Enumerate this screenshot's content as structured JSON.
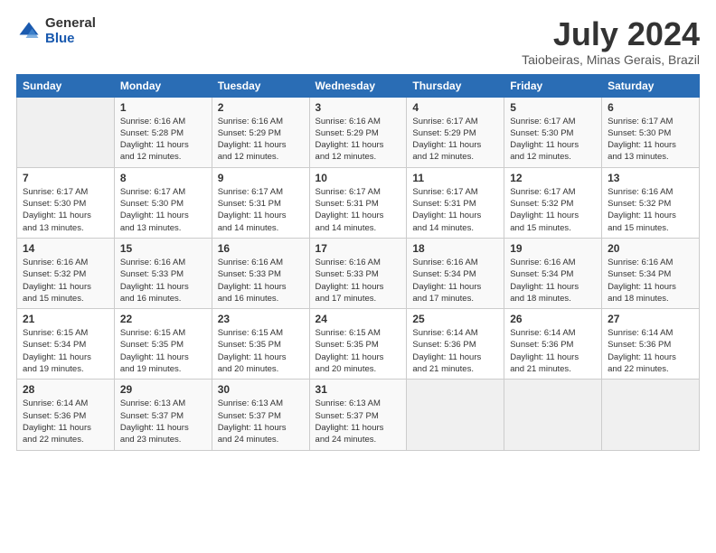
{
  "header": {
    "logo_general": "General",
    "logo_blue": "Blue",
    "main_title": "July 2024",
    "subtitle": "Taiobeiras, Minas Gerais, Brazil"
  },
  "days_of_week": [
    "Sunday",
    "Monday",
    "Tuesday",
    "Wednesday",
    "Thursday",
    "Friday",
    "Saturday"
  ],
  "weeks": [
    [
      {
        "day": "",
        "info": ""
      },
      {
        "day": "1",
        "info": "Sunrise: 6:16 AM\nSunset: 5:28 PM\nDaylight: 11 hours\nand 12 minutes."
      },
      {
        "day": "2",
        "info": "Sunrise: 6:16 AM\nSunset: 5:29 PM\nDaylight: 11 hours\nand 12 minutes."
      },
      {
        "day": "3",
        "info": "Sunrise: 6:16 AM\nSunset: 5:29 PM\nDaylight: 11 hours\nand 12 minutes."
      },
      {
        "day": "4",
        "info": "Sunrise: 6:17 AM\nSunset: 5:29 PM\nDaylight: 11 hours\nand 12 minutes."
      },
      {
        "day": "5",
        "info": "Sunrise: 6:17 AM\nSunset: 5:30 PM\nDaylight: 11 hours\nand 12 minutes."
      },
      {
        "day": "6",
        "info": "Sunrise: 6:17 AM\nSunset: 5:30 PM\nDaylight: 11 hours\nand 13 minutes."
      }
    ],
    [
      {
        "day": "7",
        "info": "Sunrise: 6:17 AM\nSunset: 5:30 PM\nDaylight: 11 hours\nand 13 minutes."
      },
      {
        "day": "8",
        "info": "Sunrise: 6:17 AM\nSunset: 5:30 PM\nDaylight: 11 hours\nand 13 minutes."
      },
      {
        "day": "9",
        "info": "Sunrise: 6:17 AM\nSunset: 5:31 PM\nDaylight: 11 hours\nand 14 minutes."
      },
      {
        "day": "10",
        "info": "Sunrise: 6:17 AM\nSunset: 5:31 PM\nDaylight: 11 hours\nand 14 minutes."
      },
      {
        "day": "11",
        "info": "Sunrise: 6:17 AM\nSunset: 5:31 PM\nDaylight: 11 hours\nand 14 minutes."
      },
      {
        "day": "12",
        "info": "Sunrise: 6:17 AM\nSunset: 5:32 PM\nDaylight: 11 hours\nand 15 minutes."
      },
      {
        "day": "13",
        "info": "Sunrise: 6:16 AM\nSunset: 5:32 PM\nDaylight: 11 hours\nand 15 minutes."
      }
    ],
    [
      {
        "day": "14",
        "info": "Sunrise: 6:16 AM\nSunset: 5:32 PM\nDaylight: 11 hours\nand 15 minutes."
      },
      {
        "day": "15",
        "info": "Sunrise: 6:16 AM\nSunset: 5:33 PM\nDaylight: 11 hours\nand 16 minutes."
      },
      {
        "day": "16",
        "info": "Sunrise: 6:16 AM\nSunset: 5:33 PM\nDaylight: 11 hours\nand 16 minutes."
      },
      {
        "day": "17",
        "info": "Sunrise: 6:16 AM\nSunset: 5:33 PM\nDaylight: 11 hours\nand 17 minutes."
      },
      {
        "day": "18",
        "info": "Sunrise: 6:16 AM\nSunset: 5:34 PM\nDaylight: 11 hours\nand 17 minutes."
      },
      {
        "day": "19",
        "info": "Sunrise: 6:16 AM\nSunset: 5:34 PM\nDaylight: 11 hours\nand 18 minutes."
      },
      {
        "day": "20",
        "info": "Sunrise: 6:16 AM\nSunset: 5:34 PM\nDaylight: 11 hours\nand 18 minutes."
      }
    ],
    [
      {
        "day": "21",
        "info": "Sunrise: 6:15 AM\nSunset: 5:34 PM\nDaylight: 11 hours\nand 19 minutes."
      },
      {
        "day": "22",
        "info": "Sunrise: 6:15 AM\nSunset: 5:35 PM\nDaylight: 11 hours\nand 19 minutes."
      },
      {
        "day": "23",
        "info": "Sunrise: 6:15 AM\nSunset: 5:35 PM\nDaylight: 11 hours\nand 20 minutes."
      },
      {
        "day": "24",
        "info": "Sunrise: 6:15 AM\nSunset: 5:35 PM\nDaylight: 11 hours\nand 20 minutes."
      },
      {
        "day": "25",
        "info": "Sunrise: 6:14 AM\nSunset: 5:36 PM\nDaylight: 11 hours\nand 21 minutes."
      },
      {
        "day": "26",
        "info": "Sunrise: 6:14 AM\nSunset: 5:36 PM\nDaylight: 11 hours\nand 21 minutes."
      },
      {
        "day": "27",
        "info": "Sunrise: 6:14 AM\nSunset: 5:36 PM\nDaylight: 11 hours\nand 22 minutes."
      }
    ],
    [
      {
        "day": "28",
        "info": "Sunrise: 6:14 AM\nSunset: 5:36 PM\nDaylight: 11 hours\nand 22 minutes."
      },
      {
        "day": "29",
        "info": "Sunrise: 6:13 AM\nSunset: 5:37 PM\nDaylight: 11 hours\nand 23 minutes."
      },
      {
        "day": "30",
        "info": "Sunrise: 6:13 AM\nSunset: 5:37 PM\nDaylight: 11 hours\nand 24 minutes."
      },
      {
        "day": "31",
        "info": "Sunrise: 6:13 AM\nSunset: 5:37 PM\nDaylight: 11 hours\nand 24 minutes."
      },
      {
        "day": "",
        "info": ""
      },
      {
        "day": "",
        "info": ""
      },
      {
        "day": "",
        "info": ""
      }
    ]
  ]
}
